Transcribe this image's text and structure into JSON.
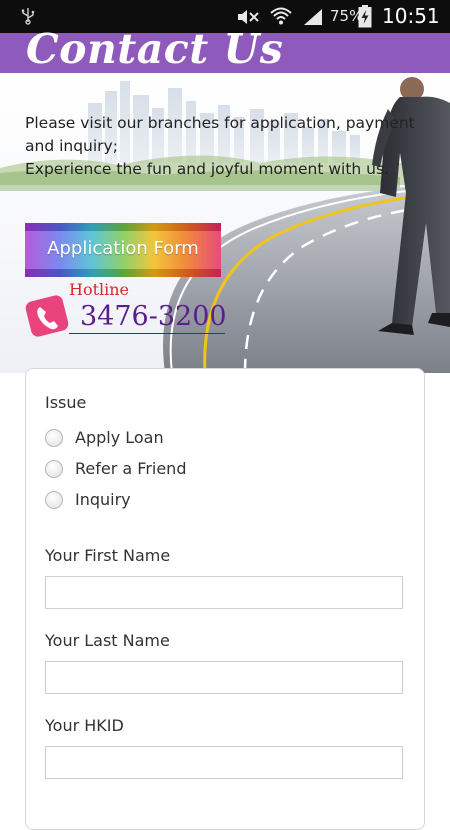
{
  "status_bar": {
    "battery_percent": "75%",
    "time": "10:51",
    "icons": [
      "usb-icon",
      "mute-icon",
      "wifi-icon",
      "signal-icon",
      "battery-charging-icon"
    ]
  },
  "header": {
    "title": "Contact Us",
    "color": "#8e5bbd"
  },
  "intro": {
    "line1": "Please visit our branches for application, payment and inquiry;",
    "line2": "Experience the fun and joyful moment with us."
  },
  "application_button": {
    "label": "Application Form"
  },
  "hotline": {
    "label": "Hotline",
    "number": "3476-3200",
    "label_color": "#d6282c",
    "number_color": "#5a1f8a"
  },
  "form": {
    "issue_label": "Issue",
    "issue_options": [
      "Apply Loan",
      "Refer a Friend",
      "Inquiry"
    ],
    "first_name_label": "Your First Name",
    "first_name_value": "",
    "last_name_label": "Your Last Name",
    "last_name_value": "",
    "hkid_label": "Your HKID",
    "hkid_value": ""
  }
}
